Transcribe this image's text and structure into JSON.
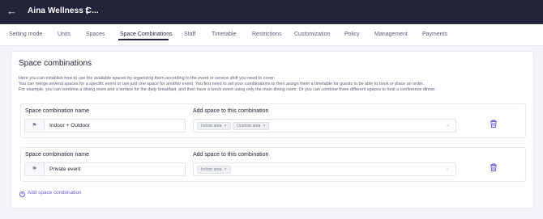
{
  "header": {
    "venue_name": "Aina Wellness C...",
    "back_icon": "arrow-left-icon",
    "caret_icon": "chevron-up-down-icon"
  },
  "tabs": [
    {
      "label": "Setting mode"
    },
    {
      "label": "Units"
    },
    {
      "label": "Spaces"
    },
    {
      "label": "Space Combinations",
      "active": true
    },
    {
      "label": "Staff"
    },
    {
      "label": "Timetable"
    },
    {
      "label": "Restrictions"
    },
    {
      "label": "Customization"
    },
    {
      "label": "Policy"
    },
    {
      "label": "Management"
    },
    {
      "label": "Payments"
    }
  ],
  "main": {
    "title": "Space combinations",
    "description": [
      "Here you can establish how to use the available spaces by organizing them according to the event or service shift you need to cover.",
      "You can merge several spaces for a specific event or use just one space for another event. You first need to set your combinations to then assign them a timetable for guests to be able to book or place an order.",
      "For example, you can combine a dining room and a terrace for the daily breakfast, and then have a lunch event using only the main dining room. Or you can combine three different spaces to host a conference dinner."
    ],
    "name_label": "Space combination name",
    "space_label": "Add space to this combination",
    "combinations": [
      {
        "name": "Indoor + Outdoor",
        "spaces": [
          "Indoor area",
          "Outdoor area"
        ]
      },
      {
        "name": "Private event",
        "spaces": [
          "Indoor area"
        ]
      }
    ],
    "add_label": "Add space combination"
  },
  "colors": {
    "topbar": "#22253a",
    "accent": "#6b5cd6",
    "delete": "#6b5cd6"
  }
}
